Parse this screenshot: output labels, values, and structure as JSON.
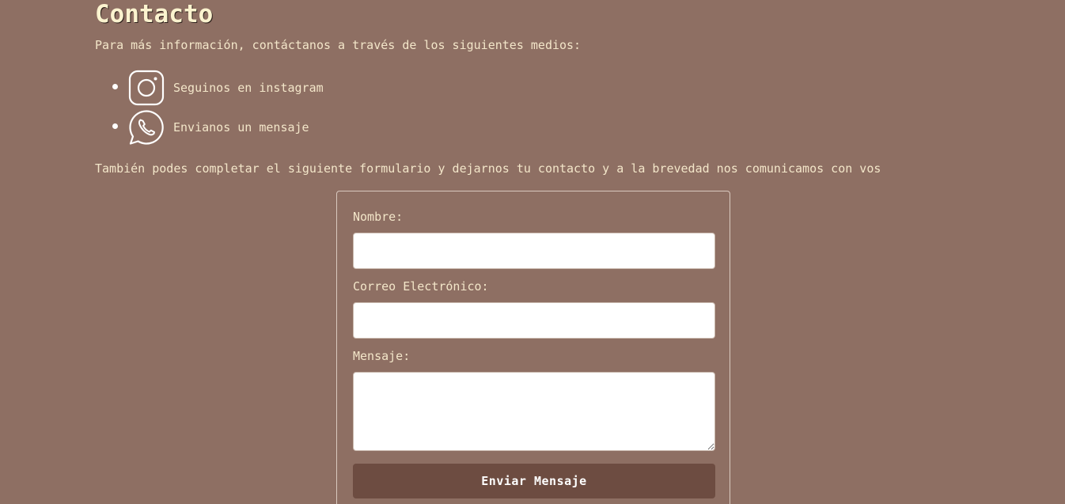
{
  "heading": {
    "title": "Contacto",
    "intro": "Para más información, contáctanos a través de los siguientes medios:"
  },
  "contacts": [
    {
      "icon": "instagram-icon",
      "label": "Seguinos en instagram"
    },
    {
      "icon": "whatsapp-icon",
      "label": "Envianos un mensaje"
    }
  ],
  "form_intro": "También podes completar el siguiente formulario y dejarnos tu contacto y a la brevedad nos comunicamos con vos",
  "form": {
    "name_label": "Nombre:",
    "name_value": "",
    "email_label": "Correo Electrónico:",
    "email_value": "",
    "message_label": "Mensaje:",
    "message_value": "",
    "submit_label": "Enviar Mensaje"
  },
  "colors": {
    "background": "#8e6f63",
    "text": "#f3e6c9",
    "title": "#fbf3cf",
    "button": "#6d4c41",
    "input_background": "#ffffff"
  }
}
